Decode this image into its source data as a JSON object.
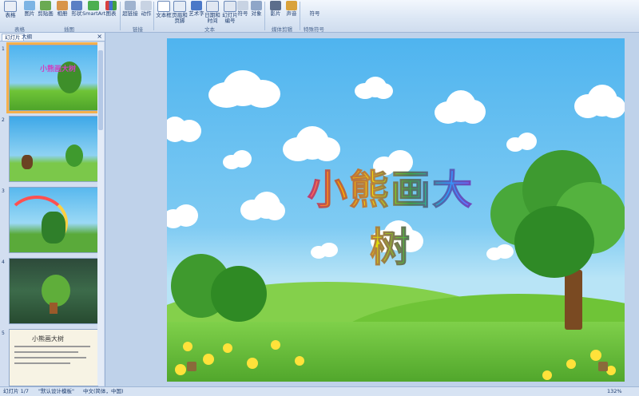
{
  "ribbon": {
    "buttons": [
      {
        "label": "表格",
        "icon": "table-icon"
      },
      {
        "label": "图片",
        "icon": "picture-icon"
      },
      {
        "label": "剪贴画",
        "icon": "clipart-icon"
      },
      {
        "label": "相册",
        "icon": "album-icon"
      },
      {
        "label": "形状",
        "icon": "shapes-icon"
      },
      {
        "label": "SmartArt",
        "icon": "smartart-icon"
      },
      {
        "label": "图表",
        "icon": "chart-icon"
      },
      {
        "label": "超链接",
        "icon": "hyperlink-icon"
      },
      {
        "label": "动作",
        "icon": "action-icon"
      },
      {
        "label": "文本框",
        "icon": "textbox-icon"
      },
      {
        "label": "页眉和页脚",
        "icon": "header-footer-icon"
      },
      {
        "label": "艺术字",
        "icon": "wordart-icon"
      },
      {
        "label": "日期和时间",
        "icon": "datetime-icon"
      },
      {
        "label": "幻灯片编号",
        "icon": "slide-number-icon"
      },
      {
        "label": "符号",
        "icon": "symbol-icon"
      },
      {
        "label": "对象",
        "icon": "object-icon"
      },
      {
        "label": "影片",
        "icon": "movie-icon"
      },
      {
        "label": "声音",
        "icon": "sound-icon"
      }
    ],
    "groups": [
      "表格",
      "插图",
      "链接",
      "文本",
      "媒体剪辑",
      "特殊符号"
    ],
    "symbol_dropdown": "符号"
  },
  "panel": {
    "tabs": [
      "幻灯片",
      "大纲"
    ],
    "close": "×",
    "slide_numbers": [
      "1",
      "2",
      "3",
      "4",
      "5"
    ],
    "slide5_title": "小熊画大树"
  },
  "slide": {
    "title": "小熊画大树"
  },
  "status": {
    "slide_info": "幻灯片 1/7",
    "theme": "\"默认设计模板\"",
    "language": "中文(简体，中国)",
    "zoom": "132%"
  },
  "colors": {
    "ribbon": "#dbe6f4",
    "accent": "#f5b04b",
    "sky": "#4fb4ef",
    "grass": "#6fc437"
  }
}
